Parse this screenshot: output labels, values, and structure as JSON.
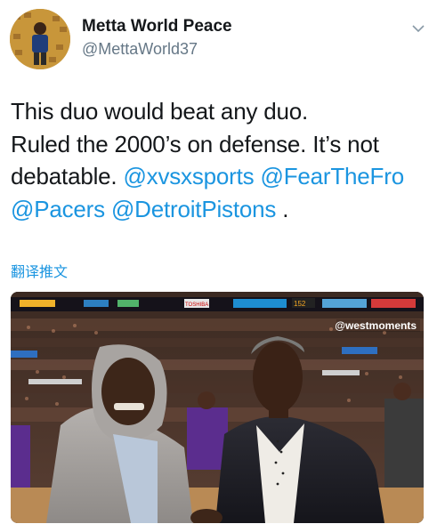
{
  "author": {
    "name": "Metta World Peace",
    "handle": "@MettaWorld37"
  },
  "tweet": {
    "line1": "This duo would beat any duo.",
    "line2": "Ruled the 2000’s on defense. It’s not",
    "line3_text": "debatable. ",
    "mention1": "@xvsxsports",
    "mention2": "@FearTheFro",
    "mention3": "@Pacers",
    "mention4": "@DetroitPistons",
    "trailing": " ."
  },
  "translate_label": "翻译推文",
  "media": {
    "watermark": "@westmoments",
    "scoreboard_text": "152",
    "sponsor_text": "TOSHIBA"
  },
  "icons": {
    "caret": "chevron-down-icon"
  },
  "colors": {
    "link": "#1b95e0",
    "secondary": "#657786",
    "text": "#14171a"
  }
}
